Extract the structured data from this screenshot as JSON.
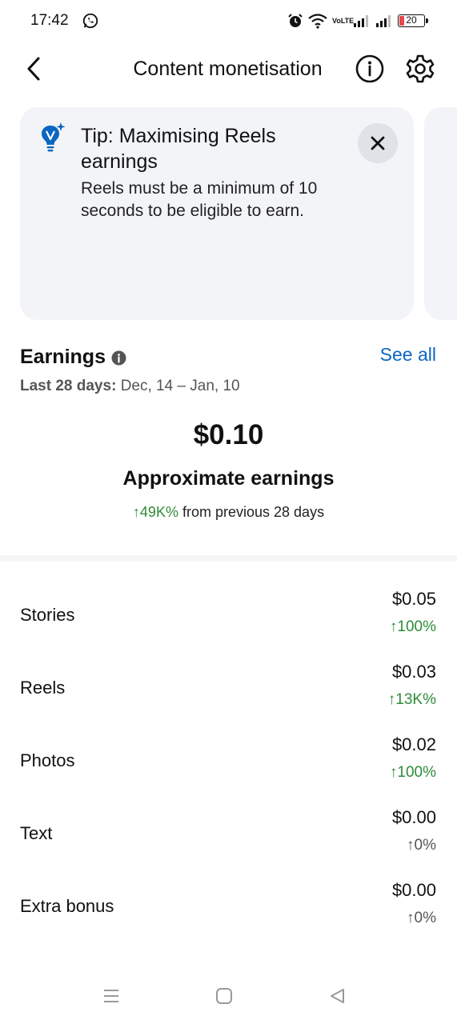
{
  "status_bar": {
    "time": "17:42",
    "network_label": "VoLTE",
    "battery_level": "20",
    "icons": [
      "whatsapp-icon",
      "alarm-icon",
      "wifi-icon",
      "volte-icon",
      "signal-icon",
      "signal-icon",
      "battery-icon"
    ],
    "battery_color": "#e5484d"
  },
  "header": {
    "title": "Content monetisation",
    "icons": [
      "back-arrow-icon",
      "info-icon",
      "settings-gear-icon"
    ]
  },
  "tip": {
    "title": "Tip: Maximising Reels earnings",
    "body": "Reels must be a minimum of 10 seconds to be eligible to earn.",
    "icon": "lightbulb-sparkle-icon",
    "accent": "#0a66c2"
  },
  "earnings": {
    "title": "Earnings",
    "see_all": "See all",
    "range_label": "Last 28 days:",
    "range_value": "Dec, 14 – Jan, 10",
    "total": "$0.10",
    "total_label": "Approximate earnings",
    "change_value": "↑49K%",
    "change_text": "from previous 28 days",
    "positive_color": "#2e8b3a",
    "link_color": "#0a66c2"
  },
  "breakdown": [
    {
      "label": "Stories",
      "amount": "$0.05",
      "change": "↑100%",
      "trend": "positive"
    },
    {
      "label": "Reels",
      "amount": "$0.03",
      "change": "↑13K%",
      "trend": "positive"
    },
    {
      "label": "Photos",
      "amount": "$0.02",
      "change": "↑100%",
      "trend": "positive"
    },
    {
      "label": "Text",
      "amount": "$0.00",
      "change": "↑0%",
      "trend": "neutral"
    },
    {
      "label": "Extra bonus",
      "amount": "$0.00",
      "change": "↑0%",
      "trend": "neutral"
    }
  ],
  "nav_bar": {
    "icons": [
      "menu-icon",
      "home-icon",
      "back-icon"
    ]
  }
}
